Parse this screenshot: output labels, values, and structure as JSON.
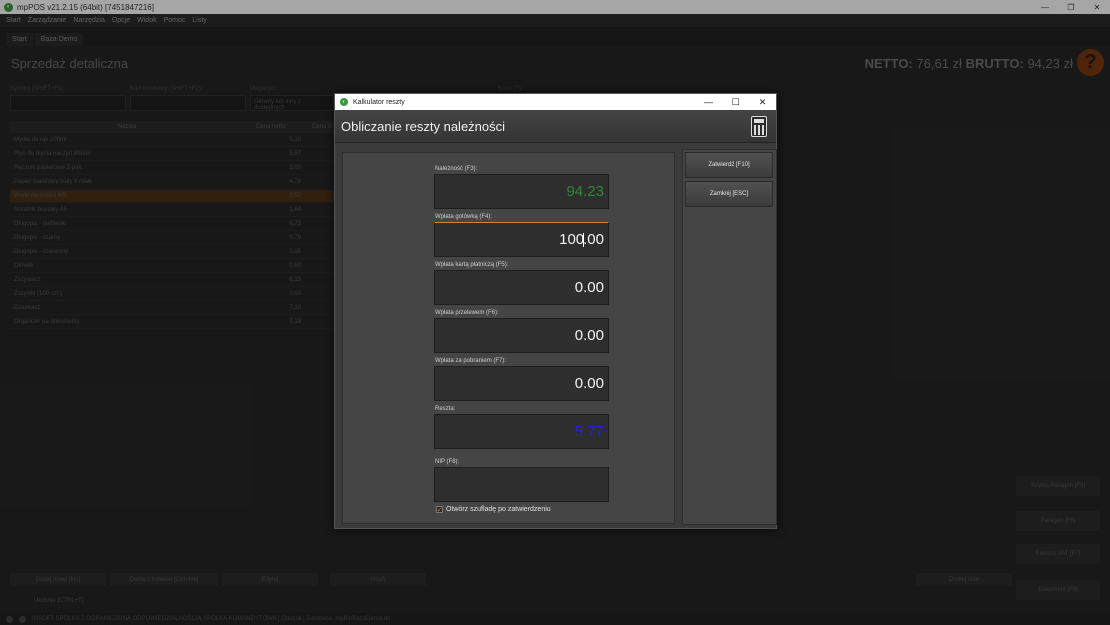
{
  "window": {
    "title": "mpPOS v21.2.15 (64bit) [7451847216]",
    "min": "—",
    "max": "❐",
    "close": "✕"
  },
  "menu": [
    "Start",
    "Zarządzanie",
    "Narzędzia",
    "Opcje",
    "Widok",
    "Pomoc",
    "Listy"
  ],
  "tabs": [
    "Start",
    "Baza Demo"
  ],
  "app": {
    "title": "Sprzedaż detaliczna",
    "netto_label": "NETTO:",
    "netto_value": "76,61 zł",
    "brutto_label": "BRUTTO:",
    "brutto_value": "94,23 zł",
    "help": "?",
    "filter_labels": [
      "Symbol (SHIFT+F3):",
      "Kod kreskowy (SHIFT+F2):",
      "Magazyn:",
      "Kolor (?)"
    ],
    "filter_placeholder": "Główny lub inny z dostępnych",
    "grid_headers": [
      "Nazwa",
      "Cena netto",
      "Cena b"
    ],
    "grid_rows": [
      {
        "name": "Mydło do rąk 200ml",
        "price": "5,10"
      },
      {
        "name": "Płyn do mycia naczyń 800ml",
        "price": "5,67"
      },
      {
        "name": "Ręcznik papierowe 2-pak",
        "price": "3,00"
      },
      {
        "name": "Papier toaletowy biały 8 rolek",
        "price": "4,78"
      },
      {
        "name": "Worki na śmieci 60L",
        "price": "2,52"
      },
      {
        "name": "Notatnik biurowy A5",
        "price": "1,64"
      },
      {
        "name": "Długopis - niebieski",
        "price": "0,73"
      },
      {
        "name": "Długopis - czarny",
        "price": "0,79"
      },
      {
        "name": "Długopis - czerwony",
        "price": "0,85"
      },
      {
        "name": "Ołówek",
        "price": "0,60"
      },
      {
        "name": "Zszywacz",
        "price": "6,15"
      },
      {
        "name": "Zszywki (100 szt.)",
        "price": "0,63"
      },
      {
        "name": "Dziurkacz",
        "price": "7,18"
      },
      {
        "name": "Organizer na dokumenty",
        "price": "7,18"
      }
    ],
    "right_buttons": [
      "Szybki Paragon [F5]",
      "Paragon [F6]",
      "Faktura VAT [F7]",
      "Dokument [F9]"
    ],
    "bottom_buttons": [
      "Dodaj nowy [Ins]",
      "Dodaj z indeksu [Ctrl+Ins]",
      "Edytuj",
      "Usuń",
      "Drukuj listę"
    ],
    "bottom_link": "Ukośnie [CTRL+T]",
    "status_text": "INSOFT SPÓŁKA Z OGRANICZONĄ ODPOWIEDZIALNOŚCIĄ SPÓŁKA KOMANDYTOWA  |  Oddział  |  Database: mpBinBazaDemo.db"
  },
  "dialog": {
    "window_title": "Kalkulator reszty",
    "min": "—",
    "max": "☐",
    "close": "✕",
    "header": "Obliczanie reszty należności",
    "due_label": "Należność (F3):",
    "due_value": "94.23",
    "cash_label": "Wpłata gotówką (F4):",
    "cash_value_a": "100",
    "cash_value_b": ".00",
    "card_label": "Wpłata kartą płatniczą (F5):",
    "card_value": "0.00",
    "transfer_label": "Wpłata przelewem (F6):",
    "transfer_value": "0.00",
    "cod_label": "Wpłata za pobraniem (F7):",
    "cod_value": "0.00",
    "change_label": "Reszta:",
    "change_value": "5.77",
    "nip_label": "NIP (F8):",
    "nip_value": "",
    "checkbox_label": "Otwórz szufladę po zatwierdzeniu",
    "checkbox_mark": "✓",
    "confirm_button": "Zatwierdź [F10]",
    "close_button": "Zamknij [ESC]"
  }
}
